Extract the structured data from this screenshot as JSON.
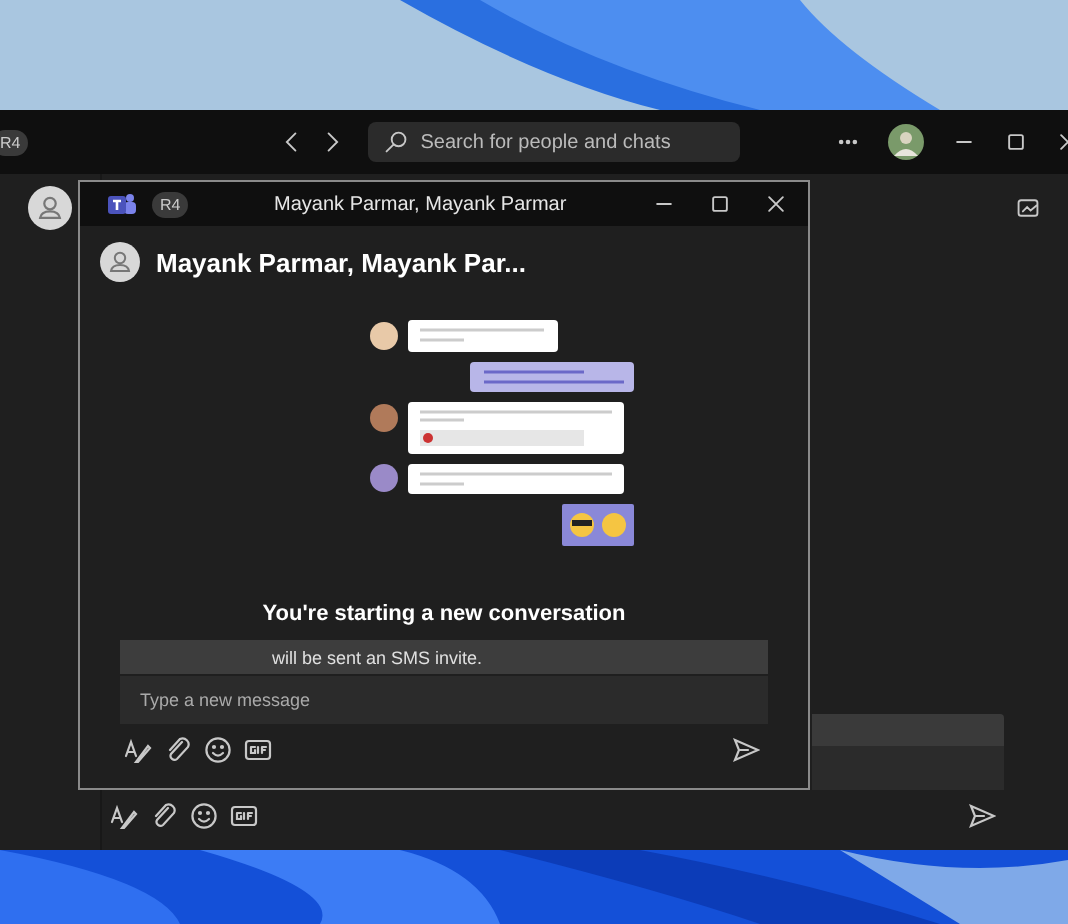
{
  "main_window": {
    "badge": "R4",
    "search": {
      "placeholder": "Search for people and chats"
    }
  },
  "chat_window": {
    "badge": "R4",
    "title": "Mayank Parmar, Mayank Parmar",
    "header": "Mayank Parmar, Mayank Par...",
    "heading": "You're starting a new conversation",
    "notice": "will be sent an SMS invite.",
    "composer": {
      "placeholder": "Type a new message"
    }
  }
}
